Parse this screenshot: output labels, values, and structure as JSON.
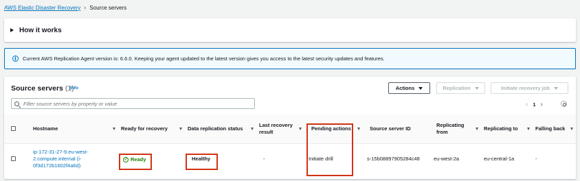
{
  "breadcrumb": {
    "parent": "AWS Elastic Disaster Recovery",
    "current": "Source servers"
  },
  "how_it_works": {
    "title": "How it works"
  },
  "alert": {
    "text": "Current AWS Replication Agent version is: 6.6.0. Keeping your agent updated to the latest version gives you access to the latest security updates and features."
  },
  "servers": {
    "title": "Source servers",
    "count": "(1)",
    "info": "Info",
    "actions_label": "Actions",
    "replication_label": "Replication",
    "initiate_label": "Initiate recovery job",
    "search_placeholder": "Filter source servers by property or value",
    "page": "1",
    "columns": [
      "Hostname",
      "Ready for recovery",
      "Data replication status",
      "Last recovery result",
      "Pending actions",
      "Source server ID",
      "Replicating from",
      "Replicating to",
      "Falling back"
    ],
    "row": {
      "hostname": "ip-172-31-27-9.eu-west-2.compute.internal (i-0f3d172b1602f4a6d)",
      "ready": "Ready",
      "replication_status": "Healthy",
      "last_result": "-",
      "pending": "Initiate drill",
      "server_id": "s-15b08897905284c48",
      "from": "eu-west-2a",
      "to": "eu-central-1a",
      "falling_back": "-"
    }
  },
  "colors": {
    "link": "#0073bb",
    "success": "#1d8102",
    "highlight": "#d13212",
    "alert_bg": "#f1faff"
  }
}
